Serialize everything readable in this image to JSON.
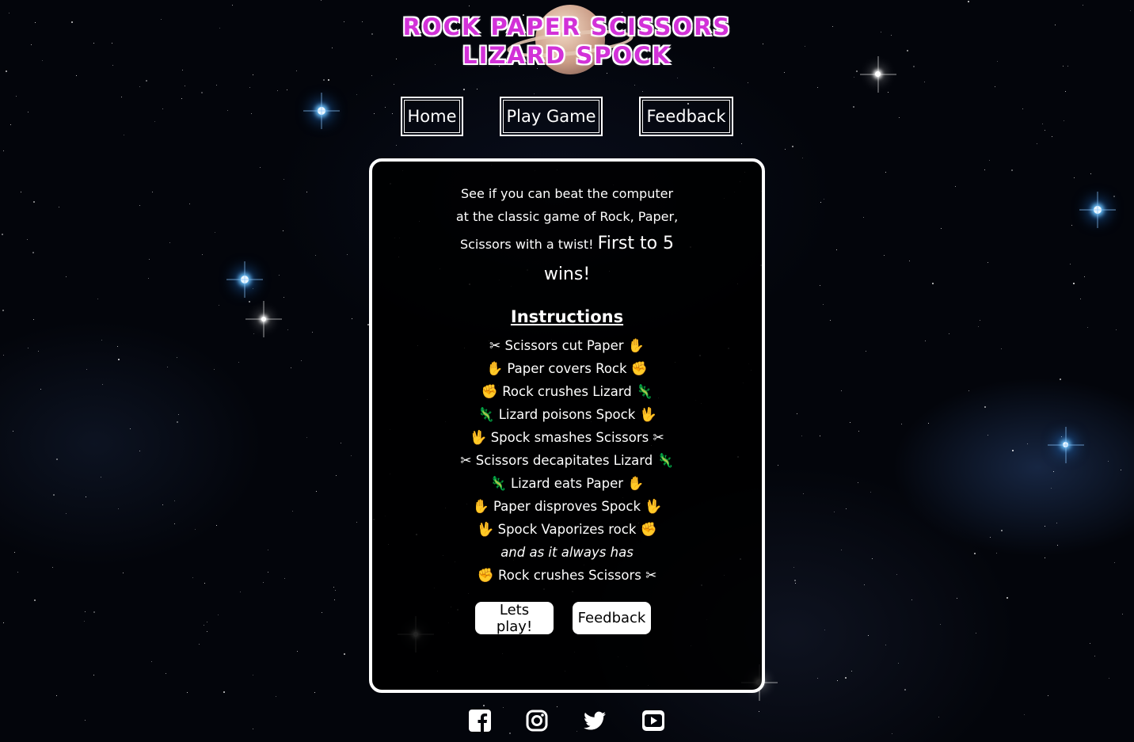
{
  "header": {
    "title_line1": "Rock Paper Scissors",
    "title_line2": "Lizard Spock"
  },
  "nav": {
    "home": "Home",
    "play_game": "Play Game",
    "feedback": "Feedback"
  },
  "intro": {
    "line1": "See if you can beat the computer",
    "line2": "at the classic game of Rock, Paper,",
    "line3": "Scissors with a twist!",
    "highlight1": "First to 5",
    "highlight2": "wins!"
  },
  "instructions": {
    "heading": "Instructions",
    "rules": [
      {
        "before": "✂",
        "text": "Scissors cut Paper",
        "after": "✋"
      },
      {
        "before": "✋",
        "text": "Paper covers Rock",
        "after": "✊"
      },
      {
        "before": "✊",
        "text": "Rock crushes Lizard",
        "after": "🦎"
      },
      {
        "before": "🦎",
        "text": "Lizard poisons Spock",
        "after": "🖖"
      },
      {
        "before": "🖖",
        "text": "Spock smashes Scissors",
        "after": "✂"
      },
      {
        "before": "✂",
        "text": "Scissors decapitates Lizard",
        "after": "🦎"
      },
      {
        "before": "🦎",
        "text": "Lizard eats Paper",
        "after": "✋"
      },
      {
        "before": "✋",
        "text": "Paper disproves Spock",
        "after": "🖖"
      },
      {
        "before": "🖖",
        "text": "Spock Vaporizes rock",
        "after": "✊"
      }
    ],
    "aside": "and as it always has",
    "final_rule": {
      "before": "✊",
      "text": "Rock crushes Scissors",
      "after": "✂"
    }
  },
  "actions": {
    "play": "Lets play!",
    "feedback": "Feedback"
  },
  "social": [
    "facebook-icon",
    "instagram-icon",
    "twitter-icon",
    "youtube-icon"
  ],
  "colors": {
    "title": "#d231d8",
    "background": "#03050b",
    "card_border": "#ffffff"
  }
}
